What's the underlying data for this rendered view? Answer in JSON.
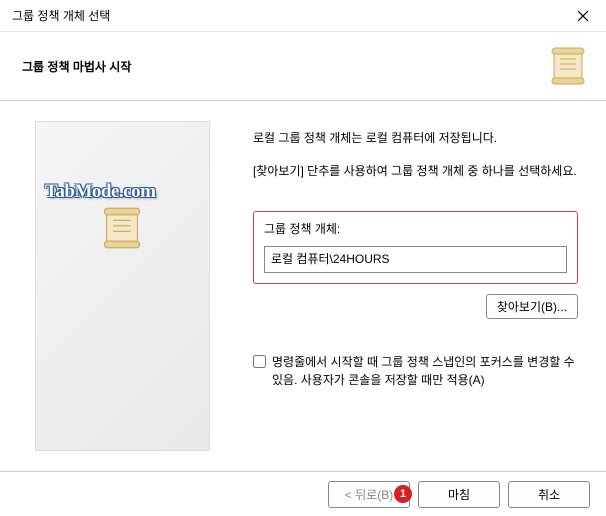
{
  "titlebar": {
    "title": "그룹 정책 개체 선택"
  },
  "header": {
    "title": "그룹 정책 마법사 시작"
  },
  "watermark": "TabMode.com",
  "content": {
    "desc1": "로컬 그룹 정책 개체는 로컬 컴퓨터에 저장됩니다.",
    "desc2": "[찾아보기] 단추를 사용하여 그룹 정책 개체 중 하나를 선택하세요.",
    "gpo_label": "그룹 정책 개체:",
    "gpo_value": "로컬 컴퓨터\\24HOURS",
    "browse_label": "찾아보기(B)...",
    "checkbox_label": "명령줄에서 시작할 때 그룹 정책 스냅인의 포커스를 변경할 수 있음. 사용자가 콘솔을 저장할 때만 적용(A)"
  },
  "footer": {
    "back": "< 뒤로(B)",
    "finish": "마침",
    "cancel": "취소",
    "badge": "1"
  }
}
